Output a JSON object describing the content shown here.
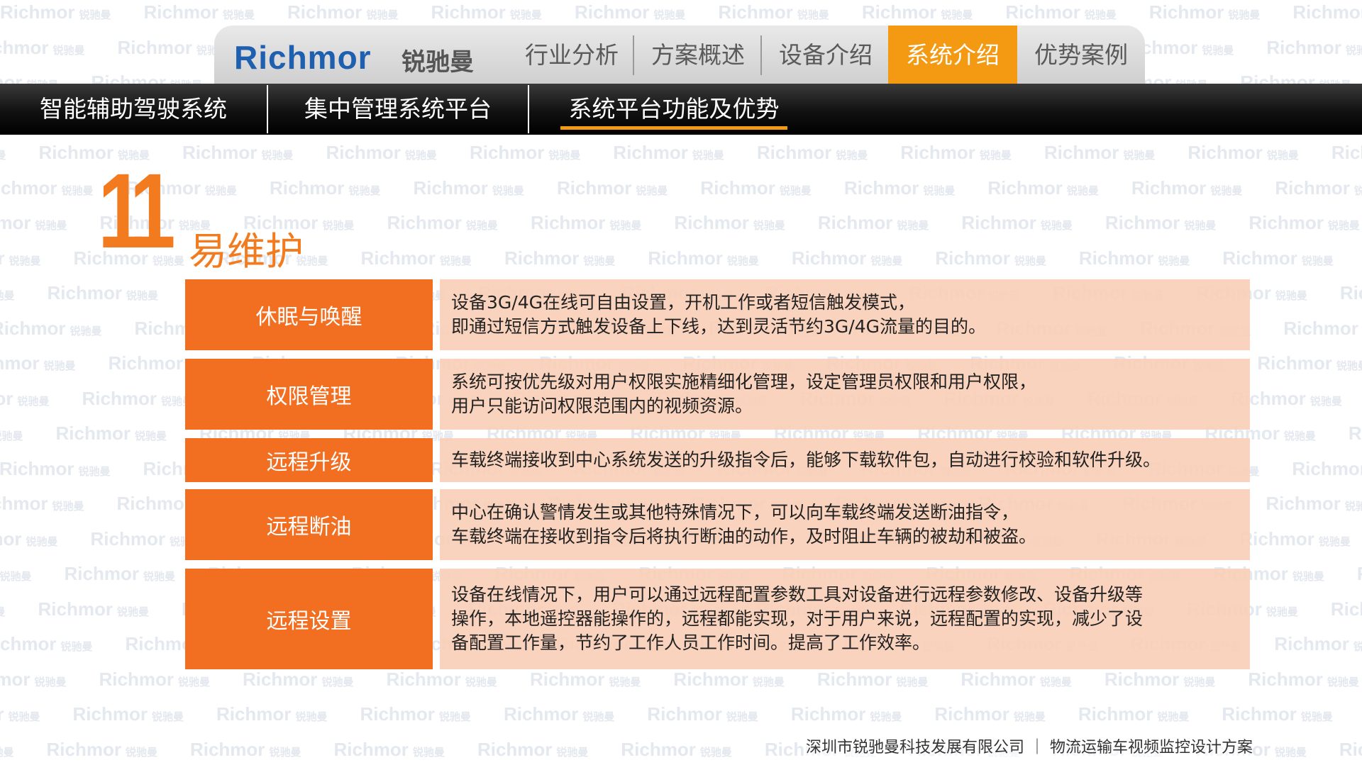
{
  "watermark": {
    "brand": "Richmor",
    "sub": "锐驰曼"
  },
  "header": {
    "logo_en": "Richmor",
    "logo_cn": "锐驰曼",
    "nav": [
      "行业分析",
      "方案概述",
      "设备介绍",
      "系统介绍",
      "优势案例"
    ],
    "active_index": 3
  },
  "subnav": {
    "items": [
      "智能辅助驾驶系统",
      "集中管理系统平台",
      "系统平台功能及优势"
    ],
    "active_index": 2
  },
  "section": {
    "number": "11",
    "title": "易维护"
  },
  "rows": [
    {
      "label": "休眠与唤醒",
      "lines": [
        "设备3G/4G在线可自由设置，开机工作或者短信触发模式，",
        "即通过短信方式触发设备上下线，达到灵活节约3G/4G流量的目的。"
      ]
    },
    {
      "label": "权限管理",
      "lines": [
        "系统可按优先级对用户权限实施精细化管理，设定管理员权限和用户权限，",
        "用户只能访问权限范围内的视频资源。"
      ]
    },
    {
      "label": "远程升级",
      "lines": [
        "车载终端接收到中心系统发送的升级指令后，能够下载软件包，自动进行校验和软件升级。"
      ]
    },
    {
      "label": "远程断油",
      "lines": [
        "中心在确认警情发生或其他特殊情况下，可以向车载终端发送断油指令，",
        "车载终端在接收到指令后将执行断油的动作，及时阻止车辆的被劫和被盗。"
      ]
    },
    {
      "label": "远程设置",
      "lines": [
        "设备在线情况下，用户可以通过远程配置参数工具对设备进行远程参数修改、设备升级等",
        "操作，本地遥控器能操作的，远程都能实现，对于用户来说，远程配置的实现，减少了设",
        "备配置工作量，节约了工作人员工作时间。提高了工作效率。"
      ]
    }
  ],
  "footer": "深圳市锐驰曼科技发展有限公司 ｜ 物流运输车视频监控设计方案",
  "colors": {
    "accent_orange": "#f26f22",
    "nav_active": "#f39a12",
    "logo_blue": "#1f5fb0",
    "desc_bg": "#f8ceb6"
  }
}
